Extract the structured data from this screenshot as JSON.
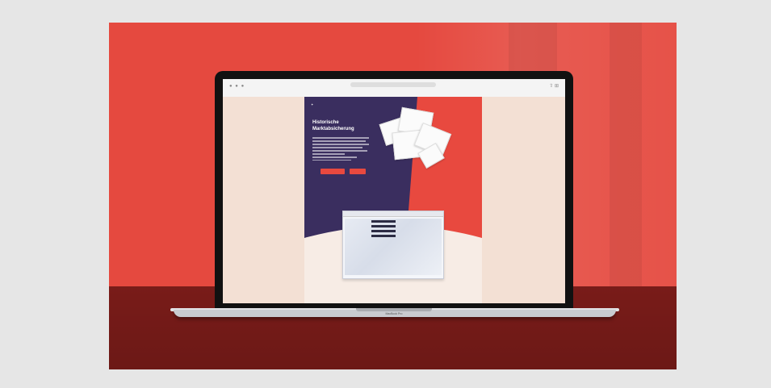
{
  "laptop": {
    "model_label": "MacBook Pro"
  },
  "browser": {
    "url": "",
    "bookmarks": [
      "",
      "",
      "",
      "",
      ""
    ]
  },
  "website": {
    "logo_text": "",
    "nav_lines": [
      "",
      ""
    ],
    "headline": [
      "Historische",
      "Marktabsicherung"
    ],
    "primary_button": "",
    "secondary_button": ""
  },
  "colors": {
    "background": "#e6e6e6",
    "wall": "#e5493f",
    "desk": "#7f1d1a",
    "site_navy": "#3a2e5f",
    "site_coral": "#e8493f",
    "site_cream": "#f7ece5"
  }
}
